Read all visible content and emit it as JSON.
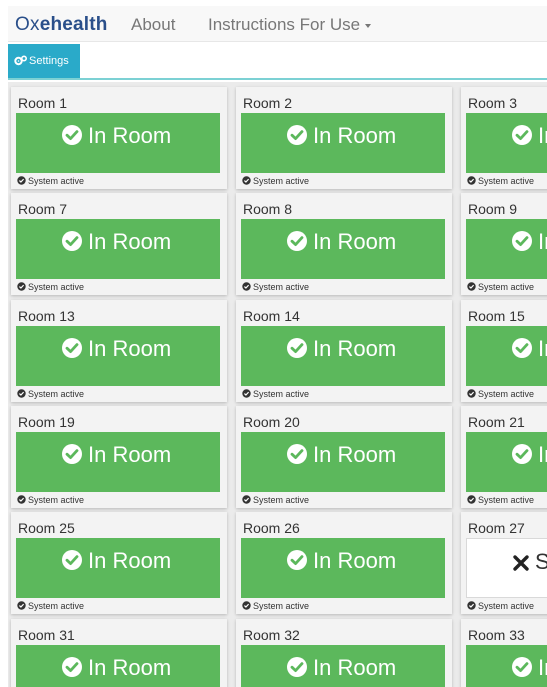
{
  "brand": {
    "prefix": "Ox",
    "rest": "ehealth"
  },
  "nav": {
    "about": "About",
    "instructions": "Instructions For Use"
  },
  "toolbar": {
    "settings_label": "Settings"
  },
  "colors": {
    "in_room": "#5cb85c",
    "settings_button": "#2aaac9",
    "brand": "#2a4f8a"
  },
  "rooms": [
    {
      "name": "Room 1",
      "status": "In Room",
      "icon": "check-circle-icon",
      "system": "System active"
    },
    {
      "name": "Room 2",
      "status": "In Room",
      "icon": "check-circle-icon",
      "system": "System active"
    },
    {
      "name": "Room 3",
      "status": "In Room",
      "icon": "check-circle-icon",
      "system": "System active"
    },
    {
      "name": "Room 7",
      "status": "In Room",
      "icon": "check-circle-icon",
      "system": "System active"
    },
    {
      "name": "Room 8",
      "status": "In Room",
      "icon": "check-circle-icon",
      "system": "System active"
    },
    {
      "name": "Room 9",
      "status": "In Room",
      "icon": "check-circle-icon",
      "system": "System active"
    },
    {
      "name": "Room 13",
      "status": "In Room",
      "icon": "check-circle-icon",
      "system": "System active"
    },
    {
      "name": "Room 14",
      "status": "In Room",
      "icon": "check-circle-icon",
      "system": "System active"
    },
    {
      "name": "Room 15",
      "status": "In Room",
      "icon": "check-circle-icon",
      "system": "System active"
    },
    {
      "name": "Room 19",
      "status": "In Room",
      "icon": "check-circle-icon",
      "system": "System active"
    },
    {
      "name": "Room 20",
      "status": "In Room",
      "icon": "check-circle-icon",
      "system": "System active"
    },
    {
      "name": "Room 21",
      "status": "In Room",
      "icon": "check-circle-icon",
      "system": "System active"
    },
    {
      "name": "Room 25",
      "status": "In Room",
      "icon": "check-circle-icon",
      "system": "System active"
    },
    {
      "name": "Room 26",
      "status": "In Room",
      "icon": "check-circle-icon",
      "system": "System active"
    },
    {
      "name": "Room 27",
      "status": "S",
      "icon": "x-icon",
      "system": "System active"
    },
    {
      "name": "Room 31",
      "status": "In Room",
      "icon": "check-circle-icon",
      "system": "System active"
    },
    {
      "name": "Room 32",
      "status": "In Room",
      "icon": "check-circle-icon",
      "system": "System active"
    },
    {
      "name": "Room 33",
      "status": "In Room",
      "icon": "check-circle-icon",
      "system": "System active"
    }
  ]
}
